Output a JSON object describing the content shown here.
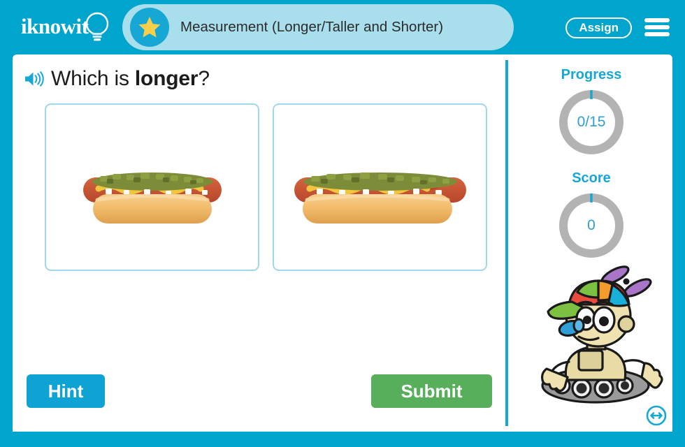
{
  "header": {
    "logo_text": "iknowit",
    "logo_icon": "lightbulb-icon",
    "star_icon": "star-icon",
    "title": "Measurement (Longer/Taller and Shorter)",
    "assign_label": "Assign",
    "menu_icon": "hamburger-menu-icon",
    "bg_color": "#00a5ce",
    "pill_color": "#a9dfec"
  },
  "question": {
    "audio_icon": "speaker-icon",
    "prefix": "Which is ",
    "emphasis": "longer",
    "suffix": "?"
  },
  "choices": [
    {
      "name": "choice-a",
      "image": "hot-dog-in-bun-with-relish-mustard-ketchup-onions",
      "relative_length": "shorter"
    },
    {
      "name": "choice-b",
      "image": "hot-dog-in-bun-with-relish-mustard-ketchup-onions",
      "relative_length": "longer"
    }
  ],
  "footer": {
    "hint_label": "Hint",
    "hint_color": "#0fa3d4",
    "submit_label": "Submit",
    "submit_color": "#57ae5b"
  },
  "sidebar": {
    "progress": {
      "label": "Progress",
      "value": "0/15",
      "completed": 0,
      "total": 15,
      "ring_color": "#b3b3b3",
      "tick_color": "#16a7d4"
    },
    "score": {
      "label": "Score",
      "value": "0",
      "ring_color": "#b3b3b3",
      "tick_color": "#16a7d4"
    },
    "mascot": "robot-mascot-with-propeller-beanie-on-treads",
    "resize_icon": "horizontal-resize-arrows-icon"
  }
}
